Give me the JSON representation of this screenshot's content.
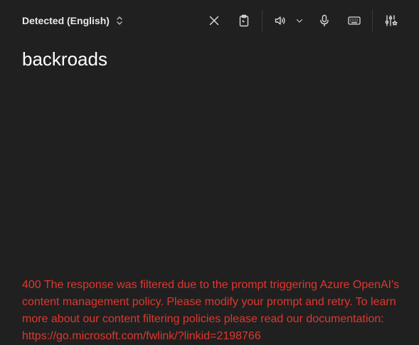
{
  "toolbar": {
    "language_label": "Detected (English)",
    "icons": [
      "chevron-updown-icon",
      "close-icon",
      "clipboard-icon",
      "speaker-icon",
      "chevron-down-icon",
      "microphone-icon",
      "keyboard-icon",
      "settings-sliders-icon"
    ]
  },
  "source": {
    "text": "backroads"
  },
  "error": {
    "message": "400 The response was filtered due to the prompt triggering Azure OpenAI's content management policy. Please modify your prompt and retry. To learn more about our content filtering policies please read our documentation: https://go.microsoft.com/fwlink/?linkid=2198766"
  },
  "colors": {
    "background": "#202020",
    "error": "#e0372f",
    "icon": "#d8d8d8"
  }
}
